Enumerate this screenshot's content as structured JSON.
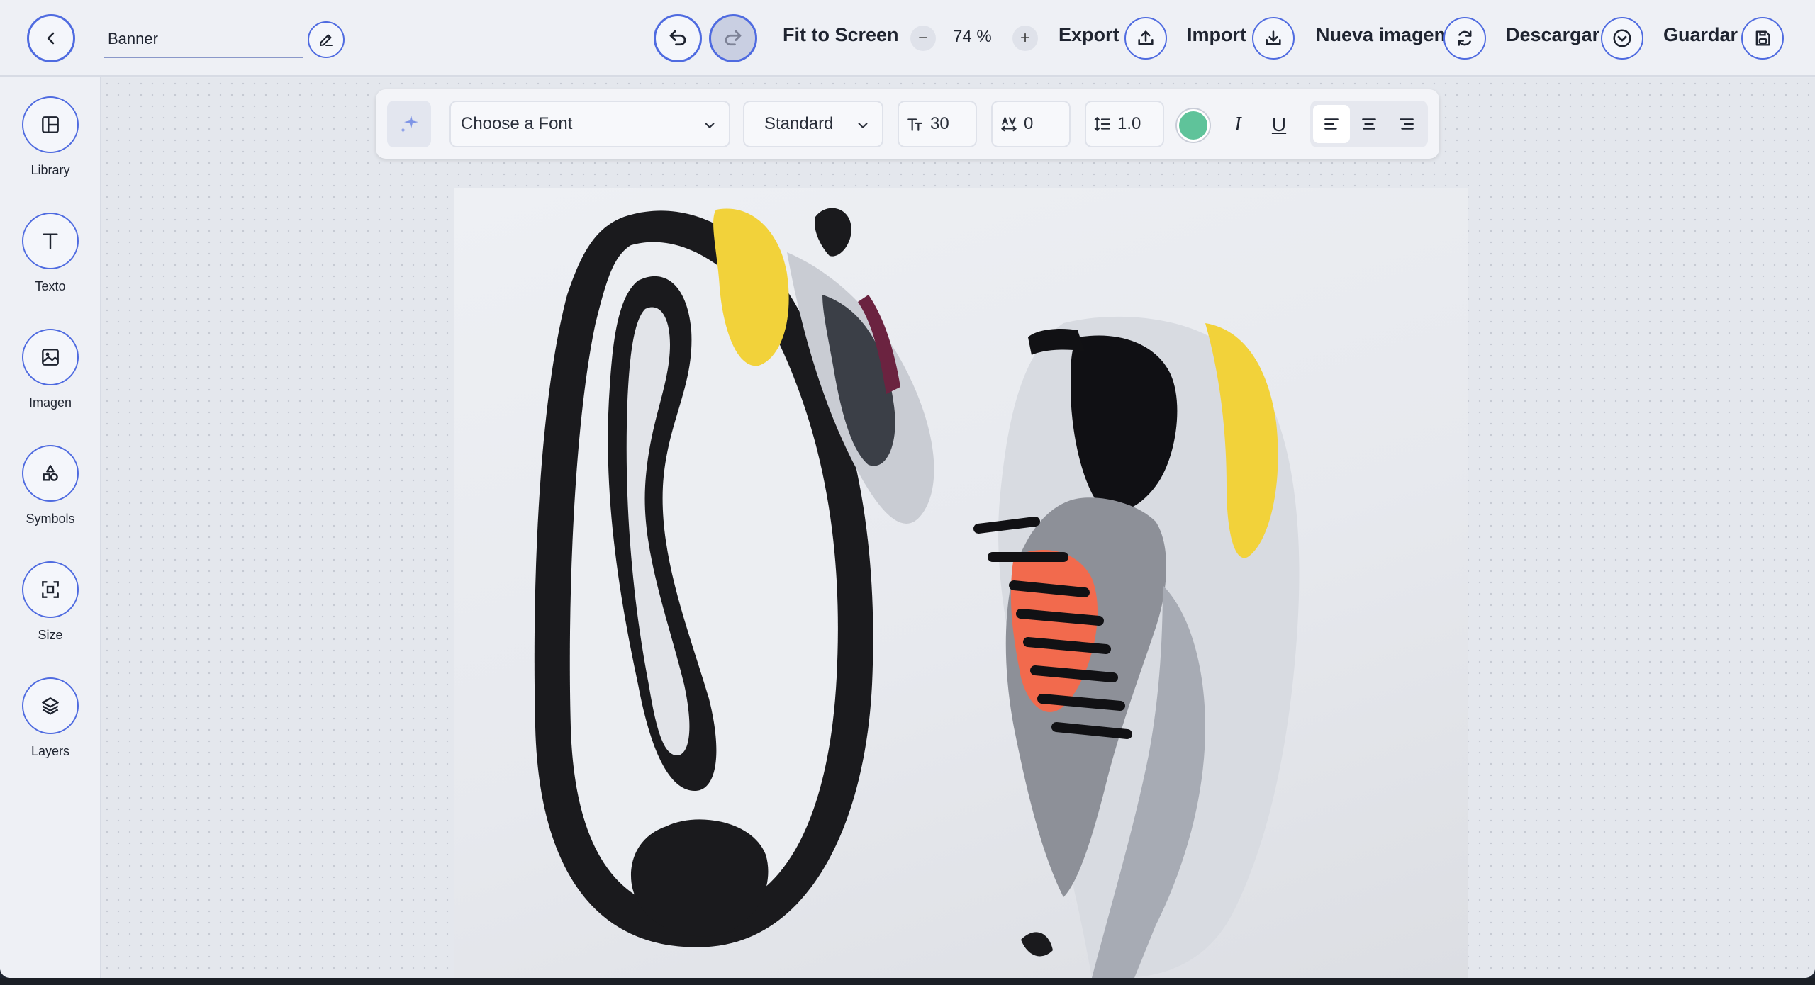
{
  "header": {
    "title_value": "Banner",
    "fit_to_screen": "Fit to Screen",
    "zoom_value": "74 %",
    "zoom_minus": "−",
    "zoom_plus": "+",
    "export": "Export",
    "import": "Import",
    "new_image": "Nueva imagen",
    "download": "Descargar",
    "save": "Guardar"
  },
  "sidebar": {
    "items": [
      {
        "label": "Library",
        "icon": "library-icon"
      },
      {
        "label": "Texto",
        "icon": "text-icon"
      },
      {
        "label": "Imagen",
        "icon": "image-icon"
      },
      {
        "label": "Symbols",
        "icon": "symbols-icon"
      },
      {
        "label": "Size",
        "icon": "size-icon"
      },
      {
        "label": "Layers",
        "icon": "layers-icon"
      }
    ]
  },
  "toolbar": {
    "font_placeholder": "Choose a Font",
    "style": "Standard",
    "font_size": "30",
    "letter_spacing": "0",
    "line_height": "1.0",
    "text_color": "#5fc39a",
    "italic": "I",
    "underline": "U",
    "active_alignment": "left"
  },
  "colors": {
    "accent": "#4f6be0",
    "background": "#e6e9ef"
  }
}
